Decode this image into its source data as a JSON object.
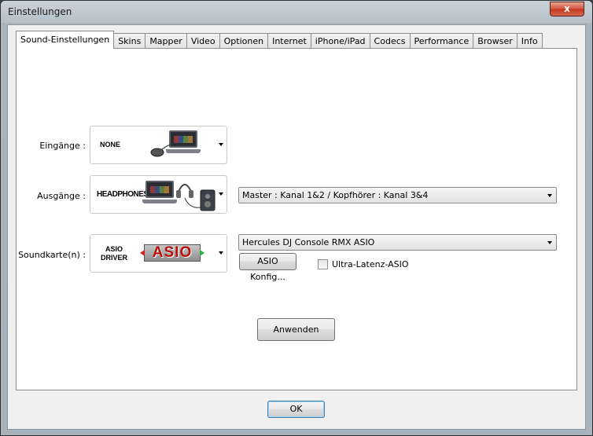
{
  "window": {
    "title": "Einstellungen",
    "close_label": "x"
  },
  "tabs": [
    {
      "label": "Sound-Einstellungen",
      "active": true
    },
    {
      "label": "Skins"
    },
    {
      "label": "Mapper"
    },
    {
      "label": "Video"
    },
    {
      "label": "Optionen"
    },
    {
      "label": "Internet"
    },
    {
      "label": "iPhone/iPad"
    },
    {
      "label": "Codecs"
    },
    {
      "label": "Performance"
    },
    {
      "label": "Browser"
    },
    {
      "label": "Info"
    }
  ],
  "inputs": {
    "label": "Eingänge :",
    "device": "NONE"
  },
  "outputs": {
    "label": "Ausgänge :",
    "device": "HEADPHONES",
    "routing": "Master : Kanal 1&2 / Kopfhörer : Kanal 3&4"
  },
  "soundcard": {
    "label": "Soundkarte(n) :",
    "device_line1": "ASIO",
    "device_line2": "DRIVER",
    "logo_text": "ASIO",
    "selected": "Hercules DJ Console RMX ASIO",
    "config_button": "ASIO Konfig...",
    "ultra_latency_label": "Ultra-Latenz-ASIO",
    "ultra_latency_checked": false
  },
  "apply_button": "Anwenden",
  "ok_button": "OK"
}
